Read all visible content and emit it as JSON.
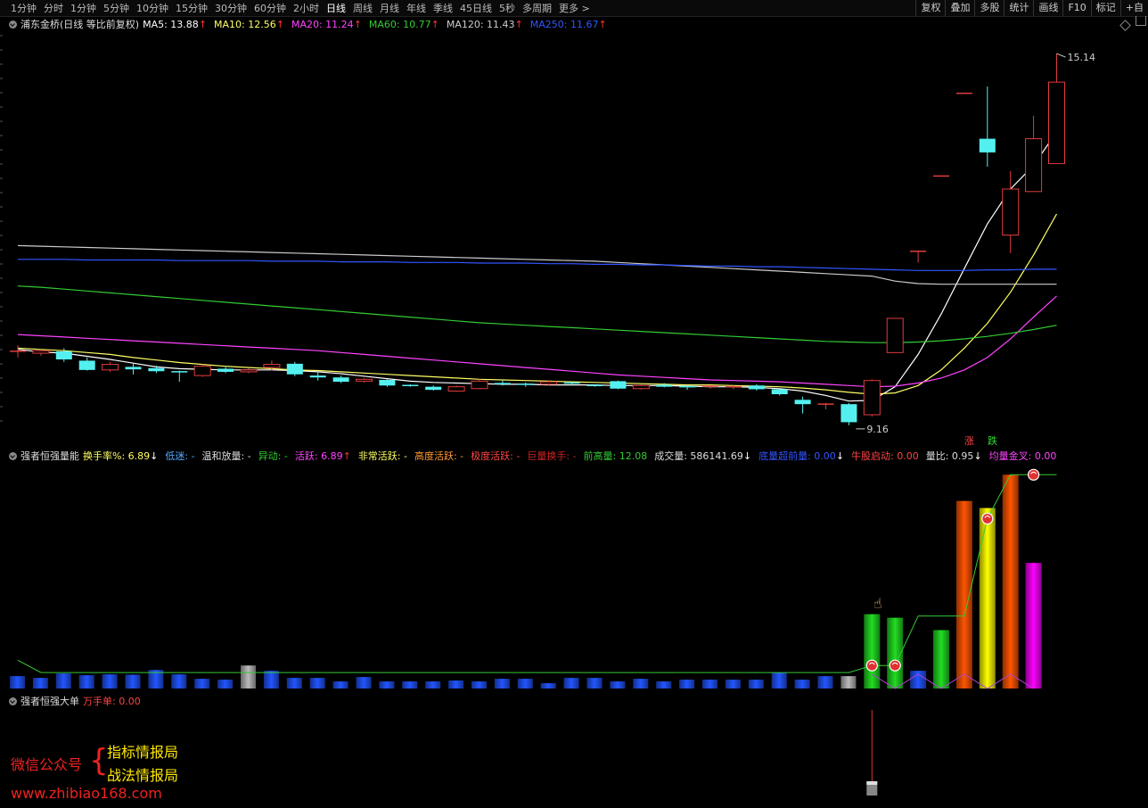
{
  "toolbar": {
    "periods": [
      "1分钟",
      "分时",
      "1分钟",
      "5分钟",
      "10分钟",
      "15分钟",
      "30分钟",
      "60分钟",
      "2小时",
      "日线",
      "周线",
      "月线",
      "年线",
      "季线",
      "45日线",
      "5秒",
      "多周期",
      "更多 >"
    ],
    "active_index": 9,
    "right_buttons": [
      "复权",
      "叠加",
      "多股",
      "统计",
      "画线",
      "F10",
      "标记",
      "+自"
    ]
  },
  "main_legend": {
    "title": "浦东金桥(日线 等比前复权)",
    "items": [
      {
        "label": "MA5: 13.88",
        "color": "#ffffff",
        "arrow": "↑"
      },
      {
        "label": "MA10: 12.56",
        "color": "#ffff66",
        "arrow": "↑"
      },
      {
        "label": "MA20: 11.24",
        "color": "#ff44ff",
        "arrow": "↑"
      },
      {
        "label": "MA60: 10.77",
        "color": "#33cc33",
        "arrow": "↑"
      },
      {
        "label": "MA120: 11.43",
        "color": "#cccccc",
        "arrow": "↑"
      },
      {
        "label": "MA250: 11.67",
        "color": "#3355ff",
        "arrow": "↑"
      }
    ],
    "price_high_label": "15.14",
    "price_low_label": "9.16",
    "tag_up": "涨",
    "tag_down": "跌"
  },
  "vol_legend": {
    "title": "强者恒强量能",
    "items": [
      {
        "label": "换手率%: 6.89",
        "color": "#ffff66",
        "arrow": "↓"
      },
      {
        "label": "低迷: -",
        "color": "#55aaff",
        "arrow": ""
      },
      {
        "label": "温和放量: -",
        "color": "#dddddd",
        "arrow": ""
      },
      {
        "label": "异动: -",
        "color": "#33cc33",
        "arrow": ""
      },
      {
        "label": "活跃: 6.89",
        "color": "#ff44ff",
        "arrow": "↑"
      },
      {
        "label": "非常活跃: -",
        "color": "#ffff66",
        "arrow": ""
      },
      {
        "label": "高度活跃: -",
        "color": "#ff9933",
        "arrow": ""
      },
      {
        "label": "极度活跃: -",
        "color": "#ff4444",
        "arrow": ""
      },
      {
        "label": "巨量换手: -",
        "color": "#cc2222",
        "arrow": ""
      },
      {
        "label": "前高量: 12.08",
        "color": "#33cc33",
        "arrow": ""
      },
      {
        "label": "成交量: 586141.69",
        "color": "#dddddd",
        "arrow": "↓"
      },
      {
        "label": "底量超前量: 0.00",
        "color": "#3355ff",
        "arrow": "↓"
      },
      {
        "label": "牛股启动: 0.00",
        "color": "#ff4444",
        "arrow": ""
      },
      {
        "label": "量比: 0.95",
        "color": "#dddddd",
        "arrow": "↓"
      },
      {
        "label": "均量金叉: 0.00",
        "color": "#ff44ff",
        "arrow": ""
      }
    ]
  },
  "big_legend": {
    "title": "强者恒强大单",
    "items": [
      {
        "label": "万手单: 0.00",
        "color": "#ff4444",
        "arrow": ""
      }
    ]
  },
  "watermark": {
    "label": "微信公众号",
    "name1": "指标情报局",
    "name2": "战法情报局",
    "url": "www.zhibiao168.com"
  },
  "chart_data": {
    "type": "candlestick",
    "price_range": [
      8.9,
      15.6
    ],
    "candles": [
      {
        "o": 10.35,
        "h": 10.45,
        "l": 10.25,
        "c": 10.35
      },
      {
        "o": 10.32,
        "h": 10.38,
        "l": 10.28,
        "c": 10.36
      },
      {
        "o": 10.35,
        "h": 10.4,
        "l": 10.18,
        "c": 10.22
      },
      {
        "o": 10.2,
        "h": 10.25,
        "l": 10.04,
        "c": 10.05
      },
      {
        "o": 10.05,
        "h": 10.18,
        "l": 10.02,
        "c": 10.14
      },
      {
        "o": 10.1,
        "h": 10.16,
        "l": 9.98,
        "c": 10.06
      },
      {
        "o": 10.08,
        "h": 10.12,
        "l": 10.0,
        "c": 10.03
      },
      {
        "o": 10.02,
        "h": 10.04,
        "l": 9.86,
        "c": 10.0
      },
      {
        "o": 9.96,
        "h": 10.14,
        "l": 9.94,
        "c": 10.11
      },
      {
        "o": 10.07,
        "h": 10.1,
        "l": 10.0,
        "c": 10.02
      },
      {
        "o": 10.02,
        "h": 10.08,
        "l": 10.0,
        "c": 10.05
      },
      {
        "o": 10.09,
        "h": 10.2,
        "l": 10.04,
        "c": 10.14
      },
      {
        "o": 10.15,
        "h": 10.18,
        "l": 9.95,
        "c": 9.98
      },
      {
        "o": 9.96,
        "h": 10.02,
        "l": 9.88,
        "c": 9.93
      },
      {
        "o": 9.93,
        "h": 9.96,
        "l": 9.84,
        "c": 9.86
      },
      {
        "o": 9.87,
        "h": 9.92,
        "l": 9.85,
        "c": 9.9
      },
      {
        "o": 9.89,
        "h": 9.9,
        "l": 9.78,
        "c": 9.8
      },
      {
        "o": 9.8,
        "h": 9.82,
        "l": 9.78,
        "c": 9.79
      },
      {
        "o": 9.78,
        "h": 9.8,
        "l": 9.72,
        "c": 9.73
      },
      {
        "o": 9.71,
        "h": 9.8,
        "l": 9.7,
        "c": 9.78
      },
      {
        "o": 9.75,
        "h": 9.9,
        "l": 9.74,
        "c": 9.87
      },
      {
        "o": 9.83,
        "h": 9.88,
        "l": 9.8,
        "c": 9.82
      },
      {
        "o": 9.82,
        "h": 9.85,
        "l": 9.78,
        "c": 9.81
      },
      {
        "o": 9.82,
        "h": 9.88,
        "l": 9.8,
        "c": 9.86
      },
      {
        "o": 9.84,
        "h": 9.86,
        "l": 9.8,
        "c": 9.82
      },
      {
        "o": 9.8,
        "h": 9.82,
        "l": 9.78,
        "c": 9.79
      },
      {
        "o": 9.87,
        "h": 9.88,
        "l": 9.74,
        "c": 9.75
      },
      {
        "o": 9.75,
        "h": 9.82,
        "l": 9.73,
        "c": 9.8
      },
      {
        "o": 9.81,
        "h": 9.84,
        "l": 9.77,
        "c": 9.78
      },
      {
        "o": 9.78,
        "h": 9.8,
        "l": 9.73,
        "c": 9.76
      },
      {
        "o": 9.78,
        "h": 9.8,
        "l": 9.75,
        "c": 9.79
      },
      {
        "o": 9.76,
        "h": 9.8,
        "l": 9.74,
        "c": 9.78
      },
      {
        "o": 9.8,
        "h": 9.82,
        "l": 9.72,
        "c": 9.74
      },
      {
        "o": 9.74,
        "h": 9.76,
        "l": 9.64,
        "c": 9.66
      },
      {
        "o": 9.57,
        "h": 9.62,
        "l": 9.35,
        "c": 9.5
      },
      {
        "o": 9.48,
        "h": 9.52,
        "l": 9.42,
        "c": 9.5
      },
      {
        "o": 9.5,
        "h": 9.52,
        "l": 9.16,
        "c": 9.21
      },
      {
        "o": 9.33,
        "h": 9.9,
        "l": 9.3,
        "c": 9.88
      },
      {
        "o": 10.33,
        "h": 10.88,
        "l": 10.33,
        "c": 10.88
      },
      {
        "o": 11.96,
        "h": 11.96,
        "l": 11.78,
        "c": 11.96
      },
      {
        "o": 13.17,
        "h": 13.17,
        "l": 13.17,
        "c": 13.17
      },
      {
        "o": 14.5,
        "h": 14.5,
        "l": 14.5,
        "c": 14.5
      },
      {
        "o": 13.77,
        "h": 14.61,
        "l": 13.32,
        "c": 13.55
      },
      {
        "o": 12.22,
        "h": 13.25,
        "l": 11.93,
        "c": 12.96
      },
      {
        "o": 12.92,
        "h": 14.14,
        "l": 12.92,
        "c": 13.77
      },
      {
        "o": 13.37,
        "h": 15.14,
        "l": 13.37,
        "c": 14.68
      }
    ],
    "ma": [
      {
        "name": "MA5",
        "color": "#ffffff",
        "values": [
          10.38,
          10.34,
          10.32,
          10.27,
          10.22,
          10.16,
          10.1,
          10.07,
          10.06,
          10.05,
          10.05,
          10.05,
          10.04,
          10.02,
          9.99,
          9.95,
          9.91,
          9.87,
          9.85,
          9.84,
          9.83,
          9.82,
          9.82,
          9.81,
          9.81,
          9.81,
          9.8,
          9.8,
          9.8,
          9.79,
          9.78,
          9.78,
          9.77,
          9.75,
          9.71,
          9.64,
          9.55,
          9.56,
          9.78,
          10.3,
          10.95,
          11.68,
          12.4,
          12.96,
          13.34,
          13.88
        ]
      },
      {
        "name": "MA10",
        "color": "#ffff66",
        "values": [
          10.4,
          10.38,
          10.36,
          10.33,
          10.3,
          10.25,
          10.21,
          10.17,
          10.14,
          10.11,
          10.09,
          10.07,
          10.05,
          10.04,
          10.02,
          10.0,
          9.98,
          9.96,
          9.94,
          9.92,
          9.9,
          9.89,
          9.88,
          9.87,
          9.86,
          9.85,
          9.84,
          9.83,
          9.82,
          9.81,
          9.81,
          9.8,
          9.79,
          9.78,
          9.76,
          9.73,
          9.69,
          9.66,
          9.68,
          9.8,
          10.05,
          10.4,
          10.8,
          11.3,
          11.9,
          12.56
        ]
      },
      {
        "name": "MA20",
        "color": "#ff44ff",
        "values": [
          10.62,
          10.6,
          10.58,
          10.56,
          10.54,
          10.52,
          10.5,
          10.48,
          10.46,
          10.44,
          10.42,
          10.4,
          10.38,
          10.36,
          10.33,
          10.3,
          10.27,
          10.24,
          10.21,
          10.18,
          10.15,
          10.12,
          10.09,
          10.06,
          10.03,
          10.0,
          9.97,
          9.95,
          9.93,
          9.91,
          9.89,
          9.88,
          9.87,
          9.86,
          9.84,
          9.82,
          9.8,
          9.78,
          9.79,
          9.84,
          9.92,
          10.05,
          10.25,
          10.55,
          10.9,
          11.24
        ]
      },
      {
        "name": "MA60",
        "color": "#33cc33",
        "values": [
          11.4,
          11.38,
          11.35,
          11.32,
          11.29,
          11.26,
          11.23,
          11.2,
          11.17,
          11.14,
          11.11,
          11.08,
          11.05,
          11.02,
          10.99,
          10.96,
          10.93,
          10.9,
          10.87,
          10.84,
          10.81,
          10.79,
          10.77,
          10.75,
          10.73,
          10.71,
          10.69,
          10.67,
          10.65,
          10.63,
          10.61,
          10.59,
          10.57,
          10.55,
          10.53,
          10.51,
          10.5,
          10.49,
          10.49,
          10.5,
          10.52,
          10.55,
          10.59,
          10.64,
          10.7,
          10.77
        ]
      },
      {
        "name": "MA120",
        "color": "#cccccc",
        "values": [
          12.05,
          12.04,
          12.03,
          12.02,
          12.01,
          12.0,
          11.99,
          11.98,
          11.97,
          11.96,
          11.95,
          11.94,
          11.93,
          11.92,
          11.91,
          11.9,
          11.89,
          11.88,
          11.87,
          11.86,
          11.85,
          11.84,
          11.83,
          11.82,
          11.81,
          11.8,
          11.78,
          11.76,
          11.74,
          11.72,
          11.7,
          11.68,
          11.66,
          11.64,
          11.62,
          11.6,
          11.58,
          11.56,
          11.48,
          11.44,
          11.43,
          11.43,
          11.43,
          11.43,
          11.43,
          11.43
        ]
      },
      {
        "name": "MA250",
        "color": "#3355ff",
        "values": [
          11.83,
          11.83,
          11.83,
          11.82,
          11.82,
          11.82,
          11.82,
          11.81,
          11.81,
          11.81,
          11.81,
          11.8,
          11.8,
          11.8,
          11.79,
          11.79,
          11.79,
          11.78,
          11.78,
          11.78,
          11.77,
          11.77,
          11.77,
          11.76,
          11.76,
          11.75,
          11.75,
          11.74,
          11.74,
          11.73,
          11.72,
          11.72,
          11.71,
          11.71,
          11.7,
          11.69,
          11.68,
          11.67,
          11.66,
          11.65,
          11.65,
          11.65,
          11.66,
          11.66,
          11.67,
          11.67
        ]
      }
    ],
    "volume": {
      "max": 12.5,
      "values": [
        0.7,
        0.6,
        0.85,
        0.75,
        0.8,
        0.78,
        1.05,
        0.8,
        0.55,
        0.5,
        1.3,
        1.0,
        0.6,
        0.6,
        0.4,
        0.65,
        0.4,
        0.4,
        0.4,
        0.45,
        0.4,
        0.55,
        0.55,
        0.3,
        0.6,
        0.6,
        0.4,
        0.55,
        0.4,
        0.5,
        0.5,
        0.5,
        0.5,
        0.9,
        0.5,
        0.7,
        0.7,
        4.2,
        4.0,
        1.0,
        3.3,
        10.6,
        10.2,
        12.08,
        7.1
      ],
      "colors": [
        "#2255ff",
        "#2255ff",
        "#2255ff",
        "#2255ff",
        "#2255ff",
        "#2255ff",
        "#2255ff",
        "#2255ff",
        "#2255ff",
        "#2255ff",
        "#bbbbbb",
        "#2255ff",
        "#2255ff",
        "#2255ff",
        "#2255ff",
        "#2255ff",
        "#2255ff",
        "#2255ff",
        "#2255ff",
        "#2255ff",
        "#2255ff",
        "#2255ff",
        "#2255ff",
        "#2255ff",
        "#2255ff",
        "#2255ff",
        "#2255ff",
        "#2255ff",
        "#2255ff",
        "#2255ff",
        "#2255ff",
        "#2255ff",
        "#2255ff",
        "#2255ff",
        "#2255ff",
        "#2255ff",
        "#bbbbbb",
        "#22dd22",
        "#22dd22",
        "#2255ff",
        "#22dd22",
        "#ff5500",
        "#ffff00",
        "#ff5500",
        "#ff00ff"
      ],
      "markers": [
        37,
        38,
        42,
        44
      ],
      "line": [
        1.6,
        0.9,
        0.9,
        0.9,
        0.9,
        0.9,
        0.9,
        0.9,
        0.9,
        0.9,
        0.9,
        0.9,
        0.9,
        0.9,
        0.9,
        0.9,
        0.9,
        0.9,
        0.9,
        0.9,
        0.9,
        0.9,
        0.9,
        0.9,
        0.9,
        0.9,
        0.9,
        0.9,
        0.9,
        0.9,
        0.9,
        0.9,
        0.9,
        0.9,
        0.9,
        0.9,
        0.9,
        1.3,
        1.3,
        4.1,
        4.1,
        4.1,
        9.6,
        12.08,
        12.08,
        12.08
      ]
    },
    "big_order": {
      "index": 37,
      "value": 0.0
    }
  }
}
